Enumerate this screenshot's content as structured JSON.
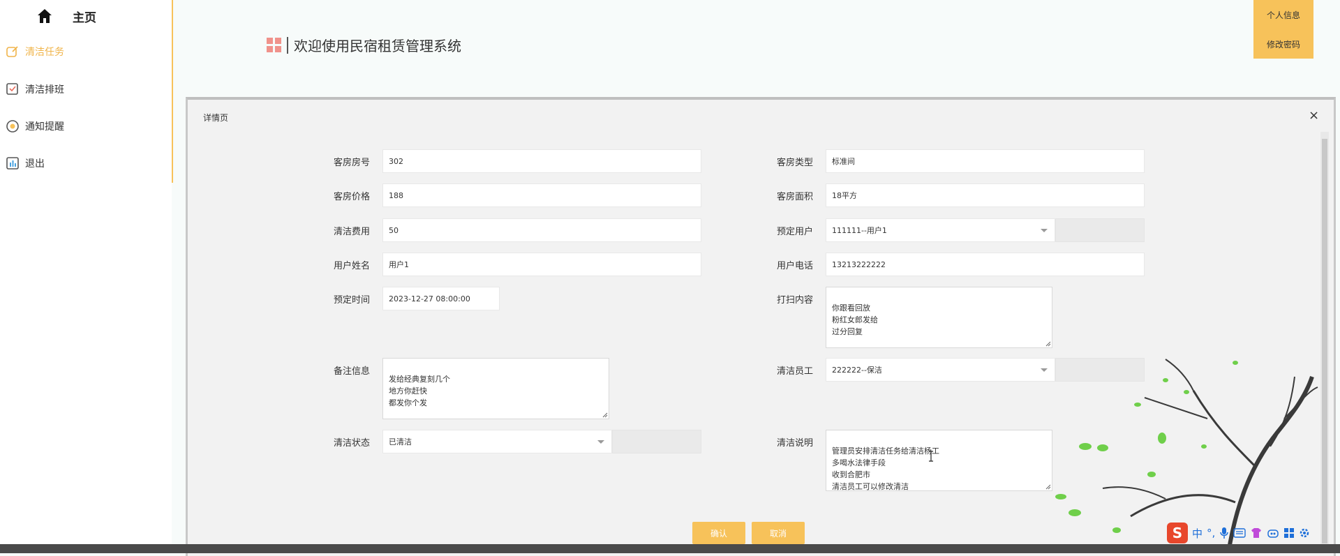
{
  "sidebar": {
    "home_label": "主页",
    "items": [
      {
        "label": "清洁任务",
        "icon": "edit-icon"
      },
      {
        "label": "清洁排班",
        "icon": "calendar-icon"
      },
      {
        "label": "通知提醒",
        "icon": "bell-icon"
      },
      {
        "label": "退出",
        "icon": "exit-icon"
      }
    ]
  },
  "header": {
    "title": "欢迎使用民宿租赁管理系统",
    "profile_label": "个人信息",
    "password_label": "修改密码"
  },
  "dialog": {
    "title": "详情页",
    "close": "×",
    "fields": {
      "room_no": {
        "label": "客房房号",
        "value": "302"
      },
      "room_type": {
        "label": "客房类型",
        "value": "标准间"
      },
      "room_price": {
        "label": "客房价格",
        "value": "188"
      },
      "room_area": {
        "label": "客房面积",
        "value": "18平方"
      },
      "clean_fee": {
        "label": "清洁费用",
        "value": "50"
      },
      "booking_user": {
        "label": "预定用户",
        "value": "111111--用户1"
      },
      "user_name": {
        "label": "用户姓名",
        "value": "用户1"
      },
      "user_phone": {
        "label": "用户电话",
        "value": "13213222222"
      },
      "booking_time": {
        "label": "预定时间",
        "value": "2023-12-27 08:00:00"
      },
      "clean_content": {
        "label": "打扫内容",
        "value": "你跟看回放\n粉红女郎发给\n过分回复"
      },
      "remarks": {
        "label": "备注信息",
        "value": "发给经典复刻几个\n地方你赶快\n都发你个发"
      },
      "cleaner": {
        "label": "清洁员工",
        "value": "222222--保洁"
      },
      "clean_status": {
        "label": "清洁状态",
        "value": "已清洁"
      },
      "clean_notes": {
        "label": "清洁说明",
        "value": "管理员安排清洁任务给清洁杨工\n多喝水法律手段\n收到合肥市\n清洁员工可以修改清洁"
      }
    },
    "confirm_label": "确认",
    "cancel_label": "取消"
  },
  "taskbar": {
    "ime_label": "中",
    "ime_logo": "S"
  },
  "colors": {
    "accent": "#f7c25a",
    "active_text": "#f0b44a",
    "grid_icon": "#f0928b"
  }
}
